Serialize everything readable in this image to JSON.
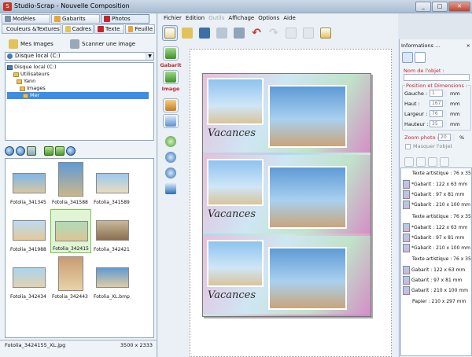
{
  "window": {
    "title": "Studio-Scrap - Nouvelle Composition"
  },
  "left_tabs_row1": [
    {
      "label": "Modèles",
      "color": "#7a8fa8"
    },
    {
      "label": "Gabarits",
      "color": "#e8a33c"
    },
    {
      "label": "Photos",
      "color": "#c0272d"
    }
  ],
  "left_tabs_row2": [
    {
      "label": "Couleurs &Textures",
      "color": "#d85b9b"
    },
    {
      "label": "Cadres",
      "color": "#e2c25b"
    },
    {
      "label": "Texte",
      "color": "#c0272d"
    },
    {
      "label": "Feuille",
      "color": "#e8a33c"
    }
  ],
  "buttons": {
    "my_images": "Mes Images",
    "scan": "Scanner une image"
  },
  "drive_combo": "Disque local (C:)",
  "tree": [
    "Disque local (C:)",
    "Utilisateurs",
    "Yann",
    "Images",
    "Mer"
  ],
  "thumbs": [
    "Fotolia_341345",
    "Fotolia_341588",
    "Fotolia_341589",
    "Fotolia_341988",
    "Fotolia_342415",
    "Fotolia_342421",
    "Fotolia_342434",
    "Fotolia_342443",
    "Fotolia_XL.bmp"
  ],
  "status": {
    "file": "Fotolia_3424155_XL.jpg",
    "dims": "3500 x 2333"
  },
  "menu": [
    "Fichier",
    "Edition",
    "Outils",
    "Affichage",
    "Options",
    "Aide"
  ],
  "vtools": {
    "gabarit": "Gabarit",
    "image": "Image"
  },
  "canvas": {
    "caption": "Vacances"
  },
  "info": {
    "title": "Informations ...",
    "name_label": "Nom de l'objet :",
    "pos_label": "Position et Dimensions :",
    "left": "Gauche :",
    "left_v": "1",
    "top": "Haut :",
    "top_v": "167",
    "width": "Largeur :",
    "width_v": "76",
    "height": "Hauteur :",
    "height_v": "35",
    "unit": "mm",
    "zoom_label": "Zoom photo :",
    "zoom_v": "20",
    "zoom_unit": "%",
    "mask_label": "Masquer l'objet"
  },
  "layers": [
    "Texte artistique : 76 x 35",
    "*Gabarit : 122 x 63 mm",
    "*Gabarit : 97 x 81 mm",
    "*Gabarit : 210 x 100 mm",
    "Texte artistique : 76 x 35",
    "*Gabarit : 122 x 63 mm",
    "*Gabarit : 97 x 81 mm",
    "*Gabarit : 210 x 100 mm",
    "Texte artistique : 76 x 35",
    "Gabarit : 122 x 63 mm",
    "Gabarit : 97 x 81 mm",
    "Gabarit : 210 x 100 mm",
    "Papier : 210 x 297 mm"
  ]
}
